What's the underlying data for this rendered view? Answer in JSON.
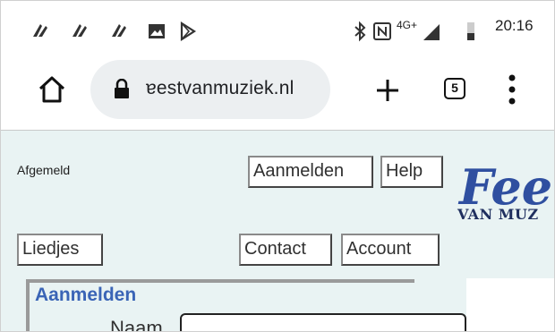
{
  "statusbar": {
    "time": "20:16",
    "network": "4G+",
    "icons": [
      "notification-icon",
      "notification-icon",
      "notification-icon",
      "image-icon",
      "play-store-icon",
      "bluetooth-icon",
      "nfc-icon",
      "signal-icon",
      "battery-icon"
    ]
  },
  "browser": {
    "url": "ɐestvanmuziek.nl",
    "tab_count": "5"
  },
  "page": {
    "status_text": "Afgemeld",
    "nav": {
      "aanmelden": "Aanmelden",
      "help": "Help",
      "liedjes": "Liedjes",
      "contact": "Contact",
      "account": "Account"
    },
    "logo": {
      "main": "Fee",
      "sub": "VAN MUZ"
    },
    "login_panel": {
      "title": "Aanmelden",
      "name_label": "Naam"
    }
  },
  "colors": {
    "page_bg": "#e9f3f3",
    "logo": "#2f4fa0",
    "panel_title": "#3a64b6"
  }
}
